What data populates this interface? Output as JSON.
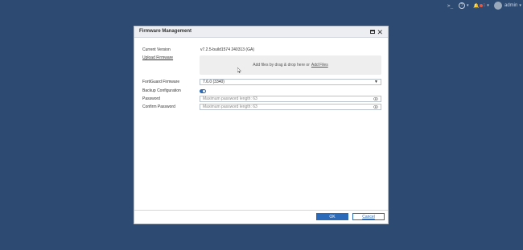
{
  "topbar": {
    "terminal_icon": "terminal-icon",
    "help_icon": "help-icon",
    "help_glyph": "?",
    "bell_icon": "bell-icon",
    "notification_count": "1",
    "user_name": "admin"
  },
  "dialog": {
    "title": "Firmware Management",
    "current_version_label": "Current Version",
    "current_version_value": "v7.2.5-build1574 240313 (GA)",
    "upload_firmware_label": "Upload Firmware",
    "dropzone_text": "Add files by drag & drop here or",
    "dropzone_link": "Add Files",
    "fortiguard_label": "FortiGuard Firmware",
    "fortiguard_value": "7.6.0 (3340)",
    "backup_label": "Backup Configuration",
    "backup_enabled": true,
    "password_label": "Password",
    "password_placeholder": "Maximum password length: 63",
    "confirm_label": "Confirm Password",
    "confirm_placeholder": "Maximum password length: 63",
    "ok_label": "OK",
    "cancel_label": "Cancel"
  },
  "colors": {
    "background": "#2d4a72",
    "accent": "#2a6ab8"
  }
}
